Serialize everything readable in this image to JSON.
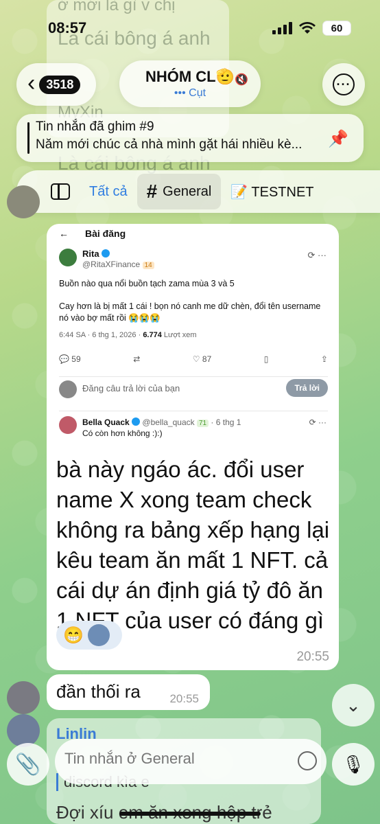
{
  "status": {
    "time": "08:57",
    "battery": "60"
  },
  "nav": {
    "back_count": "3518",
    "title": "NHÓM CL🫡",
    "subtitle": "••• Cụt"
  },
  "ghost": {
    "line1": "ở mới là gì v chị",
    "line2": "Là cái bông á anh",
    "line3": "MyXin",
    "line4": "Là cái bông á anh"
  },
  "pinned": {
    "title": "Tin nhắn đã ghim #9",
    "text": "Năm mới chúc cả nhà mình gặt hái nhiều kè..."
  },
  "tabs": [
    {
      "label": "Tất cả"
    },
    {
      "label": "General"
    },
    {
      "label": "📝 TESTNET"
    }
  ],
  "embed": {
    "header": "Bài đăng",
    "name": "Rita",
    "handle": "@RitaXFinance",
    "badge": "14",
    "line1": "Buồn nào qua nổi buồn tạch zama mùa 3 và 5",
    "line2": "Cay hơn là bị mất 1 cái ! bọn nó canh me dữ chèn, đổi tên username nó vào bợ mất rồi 😭😭😭",
    "meta_time": "6:44 SA · 6 thg 1, 2026 · ",
    "views": "6.774",
    "views_label": " Lượt xem",
    "replies": "59",
    "likes": "87",
    "reply_placeholder": "Đăng câu trả lời của bạn",
    "reply_button": "Trả lời",
    "bq_name": "Bella Quack",
    "bq_handle": " @bella_quack ",
    "bq_badge": "71",
    "bq_date": " · 6 thg 1",
    "bq_text": "Có còn hơn không :):)"
  },
  "message": {
    "text": "bà này ngáo ác. đổi user name X xong team check không ra bảng xếp hạng lại kêu team ăn mất 1 NFT. cả cái dự án định giá tỷ đô ăn 1 NFT của user có đáng gì",
    "reaction": "😁",
    "time": "20:55"
  },
  "message2": {
    "text": "đần thối ra",
    "time": "20:55"
  },
  "message3": {
    "name": "Linlin",
    "quote": "discord kìa e",
    "text": "Đợi xíu em ăn xong hộp trẻ"
  },
  "input": {
    "placeholder": "Tin nhắn ở General"
  }
}
